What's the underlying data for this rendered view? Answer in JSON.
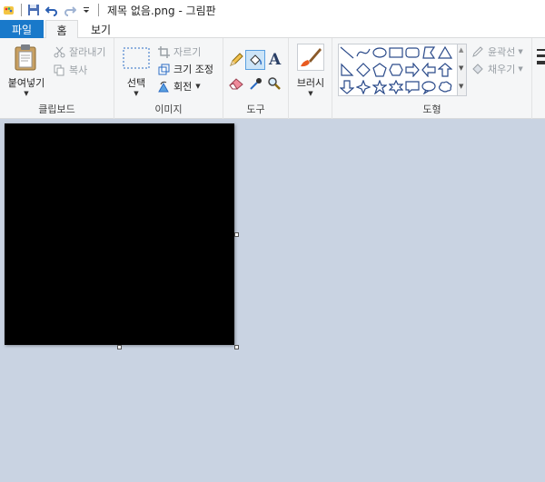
{
  "titlebar": {
    "title": "제목 없음.png - 그림판"
  },
  "tabs": {
    "file": "파일",
    "home": "홈",
    "view": "보기"
  },
  "clipboard": {
    "paste": "붙여넣기",
    "cut": "잘라내기",
    "copy": "복사",
    "group_label": "클립보드"
  },
  "image": {
    "select": "선택",
    "crop": "자르기",
    "resize": "크기 조정",
    "rotate": "회전",
    "group_label": "이미지"
  },
  "tools": {
    "group_label": "도구"
  },
  "brushes": {
    "label": "브러시"
  },
  "shapes": {
    "outline": "윤곽선",
    "fill": "채우기",
    "group_label": "도형"
  },
  "canvas": {
    "fill_color": "#000000",
    "background_color": "#c9d3e2"
  },
  "colors": {
    "accent": "#1979ca"
  }
}
